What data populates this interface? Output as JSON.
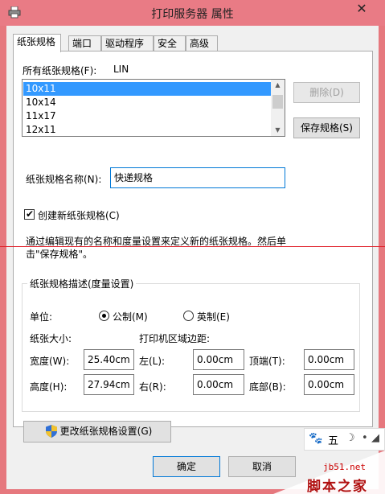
{
  "window": {
    "title": "打印服务器 属性",
    "close_glyph": "✕"
  },
  "tabs": [
    {
      "label": "纸张规格"
    },
    {
      "label": "端口"
    },
    {
      "label": "驱动程序"
    },
    {
      "label": "安全"
    },
    {
      "label": "高级"
    }
  ],
  "forms_panel": {
    "forms_on_label": "所有纸张规格(F):",
    "server_name": "LIN",
    "list_items": [
      "10x11",
      "10x14",
      "11x17",
      "12x11"
    ],
    "selected_index": 0,
    "delete_button": "删除(D)",
    "save_button": "保存规格(S)",
    "form_name_label": "纸张规格名称(N):",
    "form_name_value": "快递规格",
    "create_new_label": "创建新纸张规格(C)",
    "create_new_checked": true,
    "description_line1": "通过编辑现有的名称和度量设置来定义新的纸张规格。然后单",
    "description_line2": "击\"保存规格\"。",
    "group_title": "纸张规格描述(度量设置)",
    "units_label": "单位:",
    "metric_label": "公制(M)",
    "english_label": "英制(E)",
    "metric_selected": true,
    "paper_size_label": "纸张大小:",
    "margins_label": "打印机区域边距:",
    "width_label": "宽度(W):",
    "width_value": "25.40cm",
    "height_label": "高度(H):",
    "height_value": "27.94cm",
    "left_label": "左(L):",
    "left_value": "0.00cm",
    "right_label": "右(R):",
    "right_value": "0.00cm",
    "top_label": "顶端(T):",
    "top_value": "0.00cm",
    "bottom_label": "底部(B):",
    "bottom_value": "0.00cm",
    "change_settings_button": "更改纸张规格设置(G)"
  },
  "footer": {
    "ok_button": "确定",
    "cancel_button": "取消"
  },
  "watermark": {
    "five": "五",
    "site": "jb51.net",
    "brand": "脚本之家"
  },
  "colors": {
    "titlebar": "#e97b85",
    "selection": "#3399ff",
    "focus_border": "#0078d7",
    "red_line": "#e0202a"
  }
}
